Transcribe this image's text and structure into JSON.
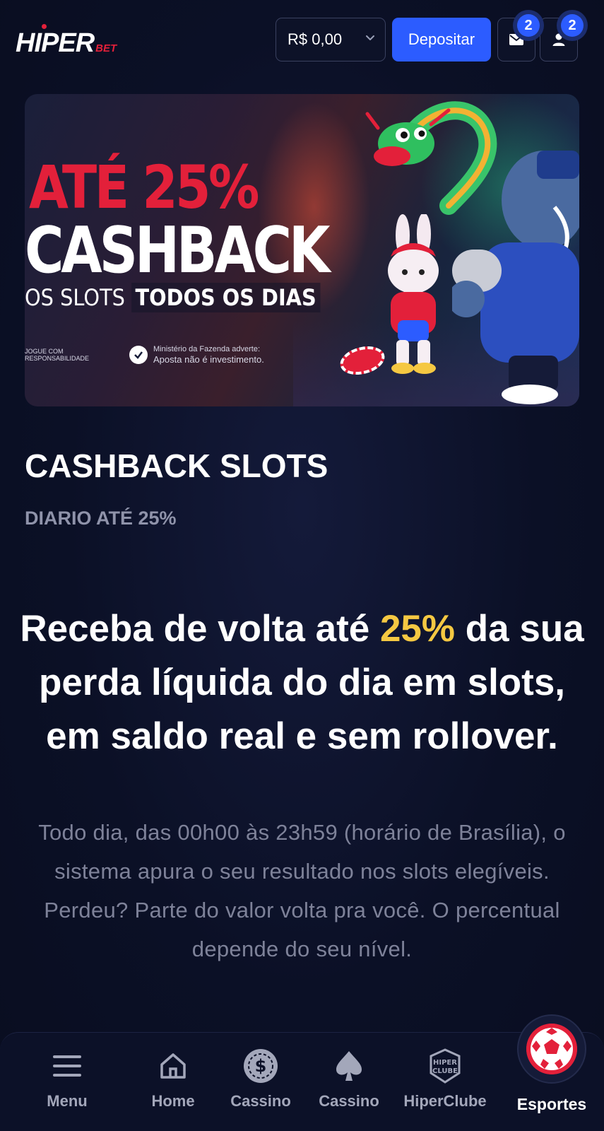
{
  "header": {
    "logo_main": "HIPER",
    "logo_sub": "BET",
    "balance": "R$ 0,00",
    "deposit_label": "Depositar",
    "mail_badge": "2",
    "user_badge": "2"
  },
  "banner": {
    "line1": "ATÉ 25%",
    "line2": "CASHBACK",
    "line3_prefix": "OS SLOTS",
    "line3_highlight": "TODOS OS DIAS",
    "disclaimer_left": "JOGUE COM RESPONSABILIDADE",
    "disclaimer_right_1": "Ministério da Fazenda adverte:",
    "disclaimer_right_2": "Aposta não é investimento."
  },
  "promo": {
    "title": "CASHBACK SLOTS",
    "subtitle": "DIARIO ATÉ 25%",
    "headline_before": "Receba de volta até",
    "headline_accent": "25%",
    "headline_after": "da sua perda líquida do dia em slots, em saldo real e sem rollover.",
    "body": "Todo dia, das 00h00 às 23h59 (horário de Brasília), o sistema apura o seu resultado nos slots elegíveis. Perdeu? Parte do valor volta pra você. O percentual depende do seu nível."
  },
  "nav": {
    "menu": "Menu",
    "home": "Home",
    "cassino1": "Cassino",
    "cassino2": "Cassino",
    "hiperclube": "HiperClube",
    "hiperclube_icon_text_1": "HIPER",
    "hiperclube_icon_text_2": "CLUBE",
    "esportes": "Esportes"
  },
  "colors": {
    "background": "#0b1026",
    "accent_blue": "#2c5cff",
    "brand_red": "#e3203a",
    "highlight_yellow": "#f5c842",
    "muted_text": "#7e8299"
  },
  "icons": [
    "chevron-down-icon",
    "mail-icon",
    "user-icon",
    "menu-icon",
    "home-icon",
    "coin-icon",
    "spade-icon",
    "hiperclube-icon",
    "soccer-ball-icon"
  ]
}
